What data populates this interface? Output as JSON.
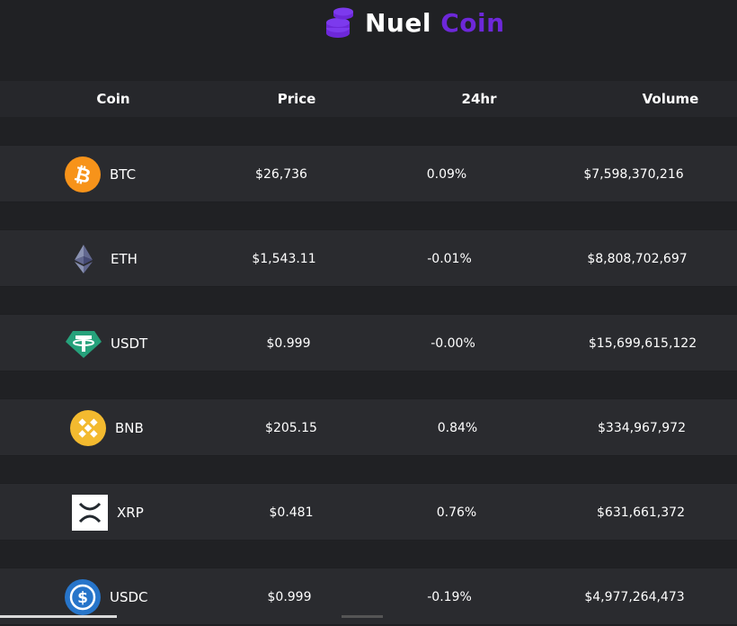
{
  "brand": {
    "name": "Nuel",
    "accent": "Coin",
    "accent_color": "#6d28d9",
    "logo_icon": "coins-stack-icon"
  },
  "table": {
    "headers": {
      "coin": "Coin",
      "price": "Price",
      "change": "24hr",
      "volume": "Volume"
    },
    "rows": [
      {
        "symbol": "BTC",
        "icon": "bitcoin-icon",
        "price": "$26,736",
        "change": "0.09%",
        "volume": "$7,598,370,216"
      },
      {
        "symbol": "ETH",
        "icon": "ethereum-icon",
        "price": "$1,543.11",
        "change": "-0.01%",
        "volume": "$8,808,702,697"
      },
      {
        "symbol": "USDT",
        "icon": "tether-icon",
        "price": "$0.999",
        "change": "-0.00%",
        "volume": "$15,699,615,122"
      },
      {
        "symbol": "BNB",
        "icon": "bnb-icon",
        "price": "$205.15",
        "change": "0.84%",
        "volume": "$334,967,972"
      },
      {
        "symbol": "XRP",
        "icon": "xrp-icon",
        "price": "$0.481",
        "change": "0.76%",
        "volume": "$631,661,372"
      },
      {
        "symbol": "USDC",
        "icon": "usdc-icon",
        "price": "$0.999",
        "change": "-0.19%",
        "volume": "$4,977,264,473"
      }
    ]
  },
  "colors": {
    "background": "#202124",
    "row": "#2a2b2f",
    "bitcoin": "#f7931a",
    "tether": "#26a17b",
    "bnb": "#f3ba2f",
    "usdc": "#2775ca"
  }
}
